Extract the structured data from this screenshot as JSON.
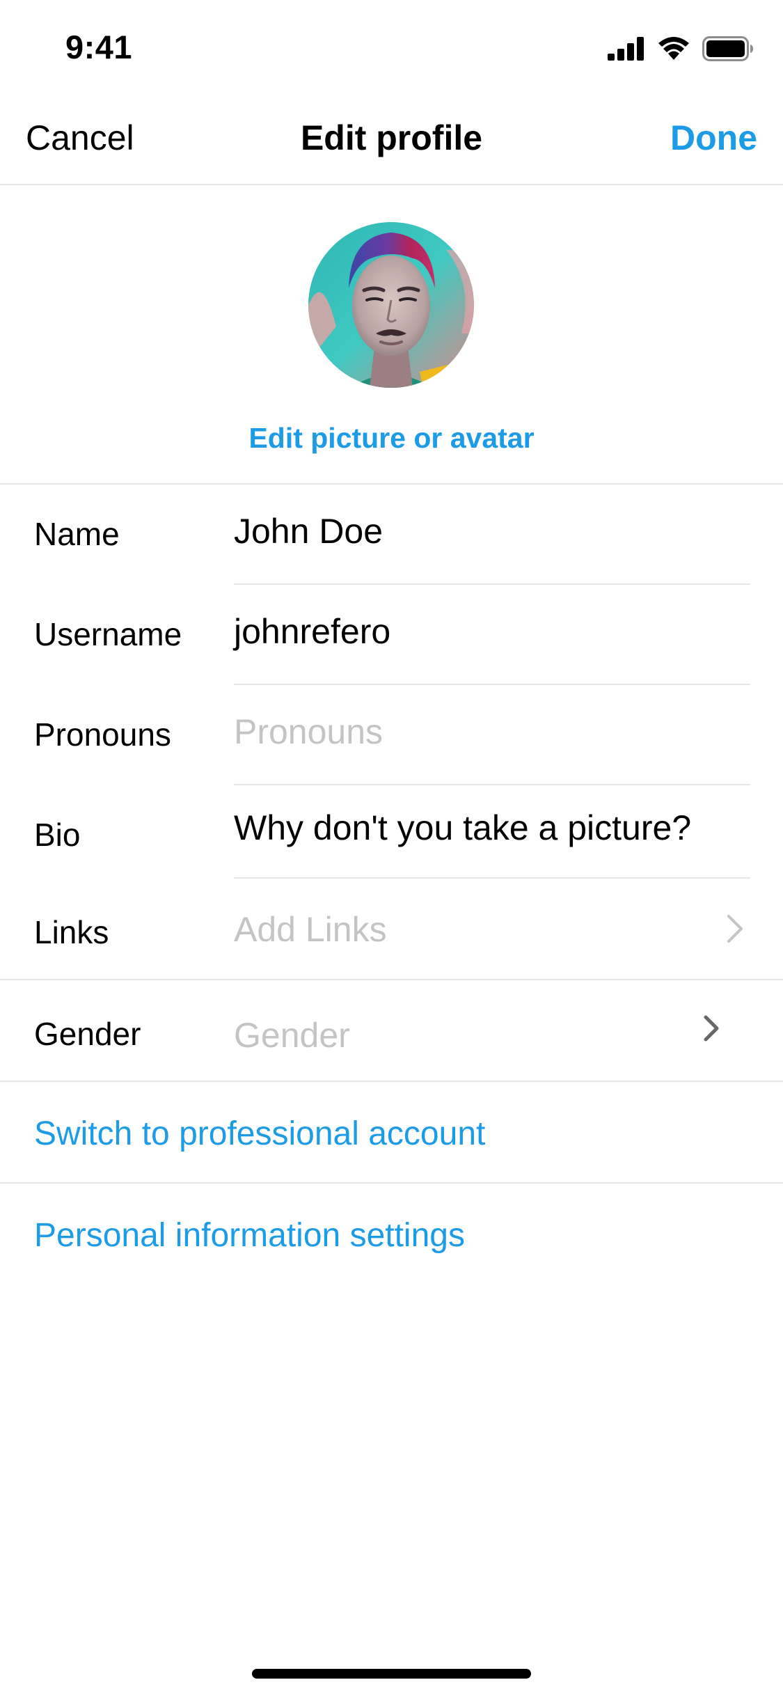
{
  "status_bar": {
    "time": "9:41",
    "icons": [
      "cellular-signal-icon",
      "wifi-icon",
      "battery-icon"
    ]
  },
  "nav": {
    "cancel_label": "Cancel",
    "title": "Edit profile",
    "done_label": "Done"
  },
  "avatar": {
    "edit_label": "Edit picture or avatar"
  },
  "form": {
    "name": {
      "label": "Name",
      "value": "John Doe"
    },
    "username": {
      "label": "Username",
      "value": "johnrefero"
    },
    "pronouns": {
      "label": "Pronouns",
      "placeholder": "Pronouns"
    },
    "bio": {
      "label": "Bio",
      "value": "Why don't you take a picture?"
    },
    "links": {
      "label": "Links",
      "placeholder": "Add Links",
      "icon": "chevron-right-icon"
    },
    "gender": {
      "label": "Gender",
      "placeholder": "Gender",
      "icon": "chevron-right-icon"
    }
  },
  "actions": {
    "professional_label": "Switch to professional account",
    "personal_info_label": "Personal information settings"
  },
  "colors": {
    "accent": "#1c9be6",
    "divider": "#e5e5ea",
    "placeholder": "#c4c4c6",
    "text": "#000000"
  }
}
